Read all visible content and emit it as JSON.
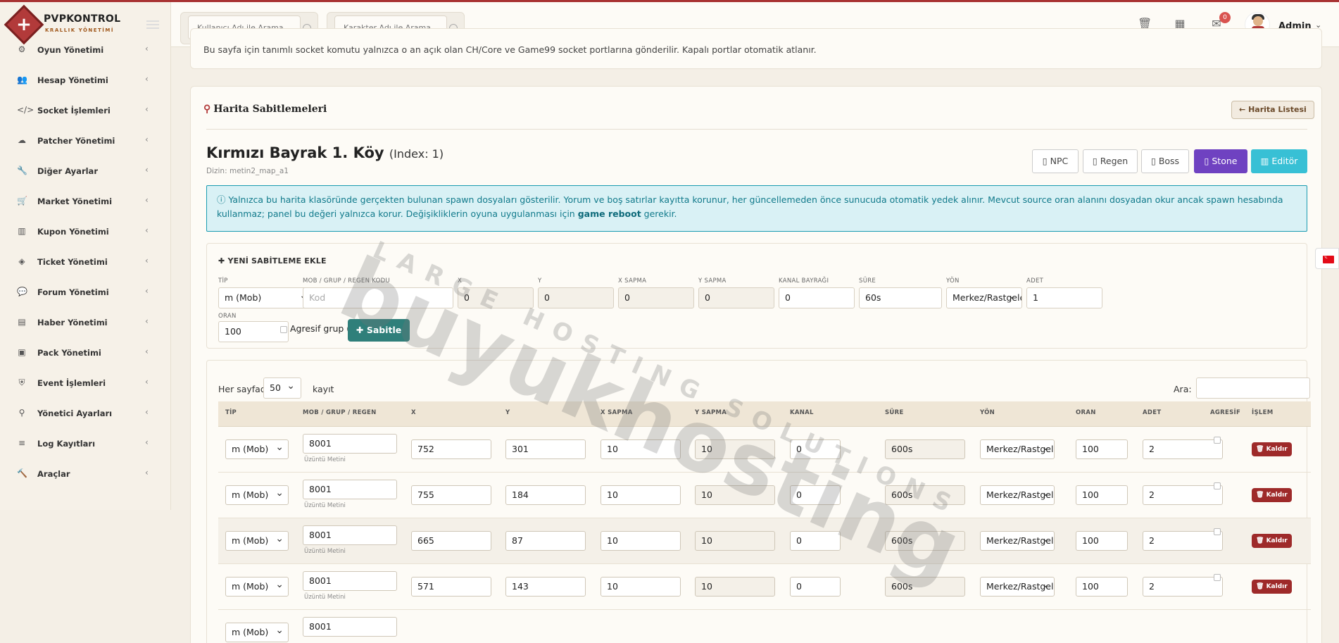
{
  "header": {
    "brand_name": "PVPKONTROL",
    "brand_sub": "KRALLIK YÖNETİMİ",
    "search_user_placeholder": "Kullanıcı Adı ile Arama",
    "search_char_placeholder": "Karakter Adı ile Arama",
    "notif_count": "0",
    "admin_name": "Admin",
    "icons": [
      "trash-icon",
      "calendar-icon",
      "messages-icon"
    ]
  },
  "sidebar": {
    "items": [
      {
        "label": "Oyun Yönetimi",
        "icon": "gamepad-icon",
        "glyph": "⚙"
      },
      {
        "label": "Hesap Yönetimi",
        "icon": "users-icon",
        "glyph": "👥"
      },
      {
        "label": "Socket İşlemleri",
        "icon": "code-icon",
        "glyph": "</>"
      },
      {
        "label": "Patcher Yönetimi",
        "icon": "cloud-icon",
        "glyph": "☁"
      },
      {
        "label": "Diğer Ayarlar",
        "icon": "wrench-icon",
        "glyph": "🔧"
      },
      {
        "label": "Market Yönetimi",
        "icon": "cart-icon",
        "glyph": "🛒"
      },
      {
        "label": "Kupon Yönetimi",
        "icon": "barcode-icon",
        "glyph": "▥"
      },
      {
        "label": "Ticket Yönetimi",
        "icon": "ticket-icon",
        "glyph": "◈"
      },
      {
        "label": "Forum Yönetimi",
        "icon": "comments-icon",
        "glyph": "💬"
      },
      {
        "label": "Haber Yönetimi",
        "icon": "newspaper-icon",
        "glyph": "▤"
      },
      {
        "label": "Pack Yönetimi",
        "icon": "archive-icon",
        "glyph": "▣"
      },
      {
        "label": "Event İşlemleri",
        "icon": "shield-icon",
        "glyph": "⛨"
      },
      {
        "label": "Yönetici Ayarları",
        "icon": "user-tie-icon",
        "glyph": "⚲"
      },
      {
        "label": "Log Kayıtları",
        "icon": "list-icon",
        "glyph": "≡"
      },
      {
        "label": "Araçlar",
        "icon": "tools-icon",
        "glyph": "🔨"
      }
    ]
  },
  "top_notice": "Bu sayfa için tanımlı socket komutu yalnızca o an açık olan CH/Core ve Game99 socket portlarına gönderilir. Kapalı portlar otomatik atlanır.",
  "card": {
    "title": "Harita Sabitlemeleri",
    "maplist_button": "Harita Listesi",
    "map_title": "Kırmızı Bayrak 1. Köy",
    "map_index": "(Index: 1)",
    "map_dir": "Dizin: metin2_map_a1",
    "tabs": [
      "NPC",
      "Regen",
      "Boss",
      "Stone",
      "Editör"
    ],
    "alert_text": "Yalnızca bu harita klasöründe gerçekten bulunan spawn dosyaları gösterilir. Yorum ve boş satırlar kayıtta korunur, her güncellemeden önce sunucuda otomatik yedek alınır. Mevcut source oran alanını dosyadan okur ancak spawn hesabında kullanmaz; panel bu değeri yalnızca korur. Değişikliklerin oyuna uygulanması için ",
    "alert_bold": "game reboot",
    "alert_tail": " gerekir."
  },
  "add_form": {
    "title": "YENİ SABİTLEME EKLE",
    "labels": {
      "tip": "TİP",
      "kod": "MOB / GRUP / REGEN KODU",
      "x": "X",
      "y": "Y",
      "xsapma": "X SAPMA",
      "ysapma": "Y SAPMA",
      "kanal": "KANAL BAYRAĞI",
      "sure": "SÜRE",
      "yon": "YÖN",
      "adet": "ADET",
      "oran": "ORAN"
    },
    "values": {
      "tip": "m (Mob)",
      "kod_placeholder": "Kod",
      "x": "0",
      "y": "0",
      "xsapma": "0",
      "ysapma": "0",
      "kanal": "0",
      "sure": "60s",
      "yon": "Merkez/Rastgele",
      "adet": "1",
      "oran": "100"
    },
    "agresif_label": "Agresif grup (ga)",
    "submit": "Sabitle"
  },
  "table": {
    "per_page_label": "Her sayfada",
    "per_page_value": "50",
    "kayit_label": "kayıt",
    "search_label": "Ara:",
    "headers": [
      "TİP",
      "MOB / GRUP / REGEN",
      "X",
      "Y",
      "X SAPMA",
      "Y SAPMA",
      "KANAL",
      "SÜRE",
      "YÖN",
      "ORAN",
      "ADET",
      "AGRESİF",
      "İŞLEM"
    ],
    "rows": [
      {
        "tip": "m (Mob)",
        "kod": "8001",
        "name": "Üzüntü Metini",
        "x": "752",
        "y": "301",
        "xs": "10",
        "ys": "10",
        "kanal": "0",
        "sure": "600s",
        "yon": "Merkez/Rastgele",
        "oran": "100",
        "adet": "2",
        "action": "Kaldır"
      },
      {
        "tip": "m (Mob)",
        "kod": "8001",
        "name": "Üzüntü Metini",
        "x": "755",
        "y": "184",
        "xs": "10",
        "ys": "10",
        "kanal": "0",
        "sure": "600s",
        "yon": "Merkez/Rastgele",
        "oran": "100",
        "adet": "2",
        "action": "Kaldır"
      },
      {
        "tip": "m (Mob)",
        "kod": "8001",
        "name": "Üzüntü Metini",
        "x": "665",
        "y": "87",
        "xs": "10",
        "ys": "10",
        "kanal": "0",
        "sure": "600s",
        "yon": "Merkez/Rastgele",
        "oran": "100",
        "adet": "2",
        "action": "Kaldır"
      },
      {
        "tip": "m (Mob)",
        "kod": "8001",
        "name": "Üzüntü Metini",
        "x": "571",
        "y": "143",
        "xs": "10",
        "ys": "10",
        "kanal": "0",
        "sure": "600s",
        "yon": "Merkez/Rastgele",
        "oran": "100",
        "adet": "2",
        "action": "Kaldır"
      },
      {
        "tip": "m (Mob)",
        "kod": "8001",
        "name": "",
        "x": "",
        "y": "",
        "xs": "",
        "ys": "",
        "kanal": "",
        "sure": "",
        "yon": "",
        "oran": "",
        "adet": "",
        "action": ""
      }
    ]
  },
  "watermark": {
    "main": "buyukhosting",
    "sub": "LARGE HOSTING SOLUTIONS"
  },
  "colors": {
    "brand": "#b23a3a",
    "purple": "#6f42c1",
    "teal": "#38c0d5",
    "sabitle": "#2f7f7a",
    "kaldir": "#9e2a2a"
  }
}
